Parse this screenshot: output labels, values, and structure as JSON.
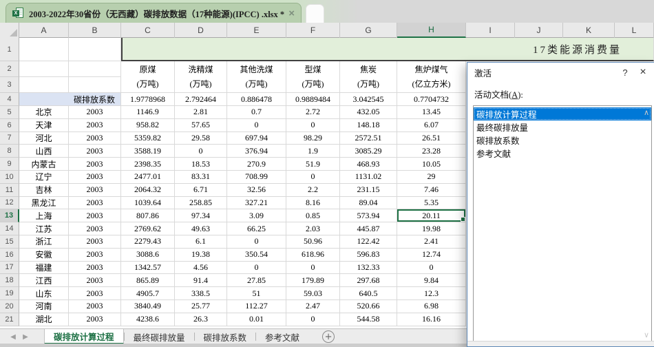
{
  "window": {
    "doc_tab_title": "2003-2022年30省份（无西藏）碳排放数据（17种能源)(IPCC) .xlsx *",
    "doc_tab_close": "×",
    "file_icon_letter": "X"
  },
  "col_letters": [
    "A",
    "B",
    "C",
    "D",
    "E",
    "F",
    "G",
    "H",
    "I",
    "J",
    "K",
    "L"
  ],
  "selection": {
    "col_letter": "H",
    "row_num": 13,
    "value": "20.11"
  },
  "sheet": {
    "banner_title": "17类能源消费量",
    "row1_num": "1",
    "header_rows_nums": [
      "2",
      "3"
    ],
    "energy_columns": [
      {
        "name": "原煤",
        "unit": "(万吨)"
      },
      {
        "name": "洗精煤",
        "unit": "(万吨)"
      },
      {
        "name": "其他洗煤",
        "unit": "(万吨)"
      },
      {
        "name": "型煤",
        "unit": "(万吨)"
      },
      {
        "name": "焦炭",
        "unit": "(万吨)"
      },
      {
        "name": "焦炉煤气",
        "unit": "(亿立方米)"
      }
    ],
    "coef_row": {
      "num": "4",
      "label": "碳排放系数",
      "values": [
        "1.9778968",
        "2.792464",
        "0.886478",
        "0.9889484",
        "3.042545",
        "0.7704732"
      ]
    },
    "rows": [
      {
        "num": "5",
        "province": "北京",
        "year": "2003",
        "values": [
          "1146.9",
          "2.81",
          "0.7",
          "2.72",
          "432.05",
          "13.45"
        ]
      },
      {
        "num": "6",
        "province": "天津",
        "year": "2003",
        "values": [
          "958.82",
          "57.65",
          "0",
          "0",
          "148.18",
          "6.07"
        ]
      },
      {
        "num": "7",
        "province": "河北",
        "year": "2003",
        "values": [
          "5359.82",
          "29.58",
          "697.94",
          "98.29",
          "2572.51",
          "26.51"
        ]
      },
      {
        "num": "8",
        "province": "山西",
        "year": "2003",
        "values": [
          "3588.19",
          "0",
          "376.94",
          "1.9",
          "3085.29",
          "23.28"
        ]
      },
      {
        "num": "9",
        "province": "内蒙古",
        "year": "2003",
        "values": [
          "2398.35",
          "18.53",
          "270.9",
          "51.9",
          "468.93",
          "10.05"
        ]
      },
      {
        "num": "10",
        "province": "辽宁",
        "year": "2003",
        "values": [
          "2477.01",
          "83.31",
          "708.99",
          "0",
          "1131.02",
          "29"
        ]
      },
      {
        "num": "11",
        "province": "吉林",
        "year": "2003",
        "values": [
          "2064.32",
          "6.71",
          "32.56",
          "2.2",
          "231.15",
          "7.46"
        ]
      },
      {
        "num": "12",
        "province": "黑龙江",
        "year": "2003",
        "values": [
          "1039.64",
          "258.85",
          "327.21",
          "8.16",
          "89.04",
          "5.35"
        ]
      },
      {
        "num": "13",
        "province": "上海",
        "year": "2003",
        "values": [
          "807.86",
          "97.34",
          "3.09",
          "0.85",
          "573.94",
          "20.11"
        ]
      },
      {
        "num": "14",
        "province": "江苏",
        "year": "2003",
        "values": [
          "2769.62",
          "49.63",
          "66.25",
          "2.03",
          "445.87",
          "19.98"
        ]
      },
      {
        "num": "15",
        "province": "浙江",
        "year": "2003",
        "values": [
          "2279.43",
          "6.1",
          "0",
          "50.96",
          "122.42",
          "2.41"
        ]
      },
      {
        "num": "16",
        "province": "安徽",
        "year": "2003",
        "values": [
          "3088.6",
          "19.38",
          "350.54",
          "618.96",
          "596.83",
          "12.74"
        ]
      },
      {
        "num": "17",
        "province": "福建",
        "year": "2003",
        "values": [
          "1342.57",
          "4.56",
          "0",
          "0",
          "132.33",
          "0"
        ]
      },
      {
        "num": "18",
        "province": "江西",
        "year": "2003",
        "values": [
          "865.89",
          "91.4",
          "27.85",
          "179.89",
          "297.68",
          "9.84"
        ]
      },
      {
        "num": "19",
        "province": "山东",
        "year": "2003",
        "values": [
          "4905.7",
          "338.5",
          "51",
          "59.03",
          "640.5",
          "12.3"
        ]
      },
      {
        "num": "20",
        "province": "河南",
        "year": "2003",
        "values": [
          "3840.49",
          "25.77",
          "112.27",
          "2.47",
          "520.66",
          "6.98"
        ]
      },
      {
        "num": "21",
        "province": "湖北",
        "year": "2003",
        "values": [
          "4238.6",
          "26.3",
          "0.01",
          "0",
          "544.58",
          "16.16"
        ]
      }
    ]
  },
  "dialog": {
    "title": "激活",
    "help_button": "?",
    "close_button": "×",
    "label_pre": "活动文档(",
    "label_key": "A",
    "label_post": "):",
    "items": [
      "碳排放计算过程",
      "最终碳排放量",
      "碳排放系数",
      "参考文献"
    ],
    "selected_index": 0,
    "scroll_up_glyph": "∧",
    "scroll_down_glyph": "∨"
  },
  "sheet_tabs": {
    "nav_prev": "◀",
    "nav_next": "▶",
    "tabs": [
      "碳排放计算过程",
      "最终碳排放量",
      "碳排放系数",
      "参考文献"
    ],
    "active_index": 0,
    "add_label": "+"
  },
  "colors": {
    "accent_green": "#1e7145",
    "banner_fill": "#e2efda",
    "coef_fill": "#dbe3f3",
    "list_selection": "#0078d7",
    "doc_tab_fill": "#b7cfae"
  }
}
